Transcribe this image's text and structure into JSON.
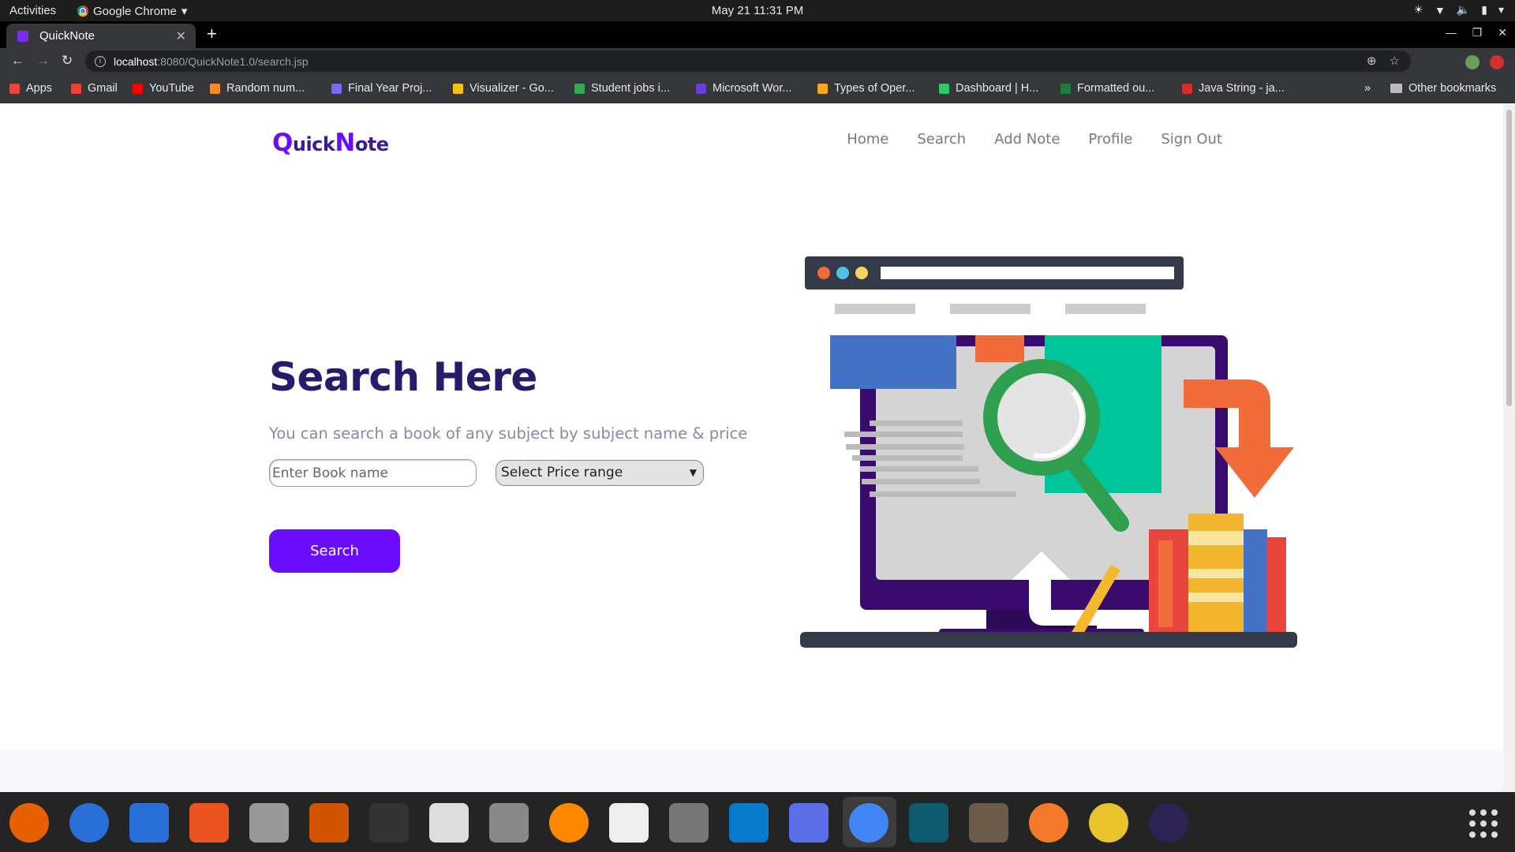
{
  "system": {
    "activities": "Activities",
    "app_menu": "Google Chrome",
    "clock": "May 21  11:31 PM"
  },
  "browser": {
    "tab_title": "QuickNote",
    "url_host": "localhost",
    "url_path": ":8080/QuickNote1.0/search.jsp",
    "bookmarks": [
      {
        "label": "Apps",
        "color": "#e8453c"
      },
      {
        "label": "Gmail",
        "color": "#ea4335"
      },
      {
        "label": "YouTube",
        "color": "#ff0000"
      },
      {
        "label": "Random num...",
        "color": "#f28b30"
      },
      {
        "label": "Final Year Proj...",
        "color": "#7b68ee"
      },
      {
        "label": "Visualizer - Go...",
        "color": "#f4c20d"
      },
      {
        "label": "Student jobs i...",
        "color": "#34a853"
      },
      {
        "label": "Microsoft Wor...",
        "color": "#6b3fd6"
      },
      {
        "label": "Types of Oper...",
        "color": "#f6a821"
      },
      {
        "label": "Dashboard | H...",
        "color": "#2ec866"
      },
      {
        "label": "Formatted ou...",
        "color": "#1a7f3c"
      },
      {
        "label": "Java String - ja...",
        "color": "#d32f2f"
      }
    ],
    "other_bookmarks": "Other bookmarks"
  },
  "site": {
    "logo_q": "Q",
    "logo_uick": "uick",
    "logo_n": "N",
    "logo_ote": "ote",
    "nav": [
      "Home",
      "Search",
      "Add Note",
      "Profile",
      "Sign Out"
    ]
  },
  "hero": {
    "title": "Search Here",
    "subtitle": "You can search a book of any subject by subject name & price",
    "book_placeholder": "Enter Book name",
    "price_select": "Select Price range",
    "search_button": "Search"
  },
  "colors": {
    "brand": "#6a0dff",
    "heading": "#2a1a6b"
  }
}
